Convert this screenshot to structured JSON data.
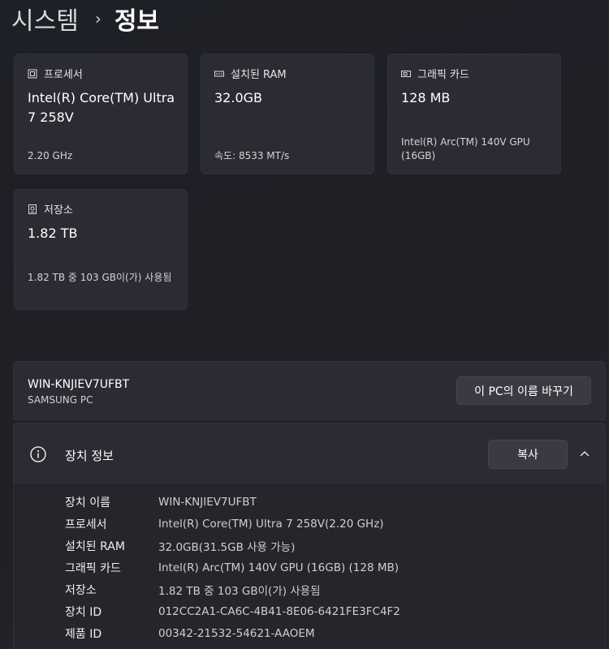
{
  "breadcrumb": {
    "parent": "시스템",
    "separator": "›",
    "current": "정보"
  },
  "cards": {
    "processor": {
      "label": "프로세서",
      "value": "Intel(R) Core(TM) Ultra 7 258V",
      "sub": "2.20 GHz",
      "icon": "processor-icon"
    },
    "ram": {
      "label": "설치된 RAM",
      "value": "32.0GB",
      "sub": "속도: 8533 MT/s",
      "icon": "ram-icon"
    },
    "graphics": {
      "label": "그래픽 카드",
      "value": "128 MB",
      "sub": "Intel(R) Arc(TM) 140V GPU (16GB)",
      "icon": "graphics-card-icon"
    },
    "storage": {
      "label": "저장소",
      "value": "1.82 TB",
      "sub": "1.82 TB 중 103 GB이(가) 사용됨",
      "icon": "storage-icon"
    }
  },
  "pc": {
    "name": "WIN-KNJIEV7UFBT",
    "model": "SAMSUNG PC",
    "rename_label": "이 PC의 이름 바꾸기"
  },
  "device_info": {
    "title": "장치 정보",
    "copy_label": "복사",
    "icon": "info-icon",
    "rows": [
      {
        "key": "장치 이름",
        "value": "WIN-KNJIEV7UFBT"
      },
      {
        "key": "프로세서",
        "value": "Intel(R) Core(TM) Ultra 7 258V(2.20 GHz)"
      },
      {
        "key": "설치된 RAM",
        "value": "32.0GB(31.5GB 사용 가능)"
      },
      {
        "key": "그래픽 카드",
        "value": "Intel(R) Arc(TM) 140V GPU (16GB) (128 MB)"
      },
      {
        "key": "저장소",
        "value": "1.82 TB 중 103 GB이(가) 사용됨"
      },
      {
        "key": "장치 ID",
        "value": "012CC2A1-CA6C-4B41-8E06-6421FE3FC4F2"
      },
      {
        "key": "제품 ID",
        "value": "00342-21532-54621-AAOEM"
      }
    ]
  }
}
